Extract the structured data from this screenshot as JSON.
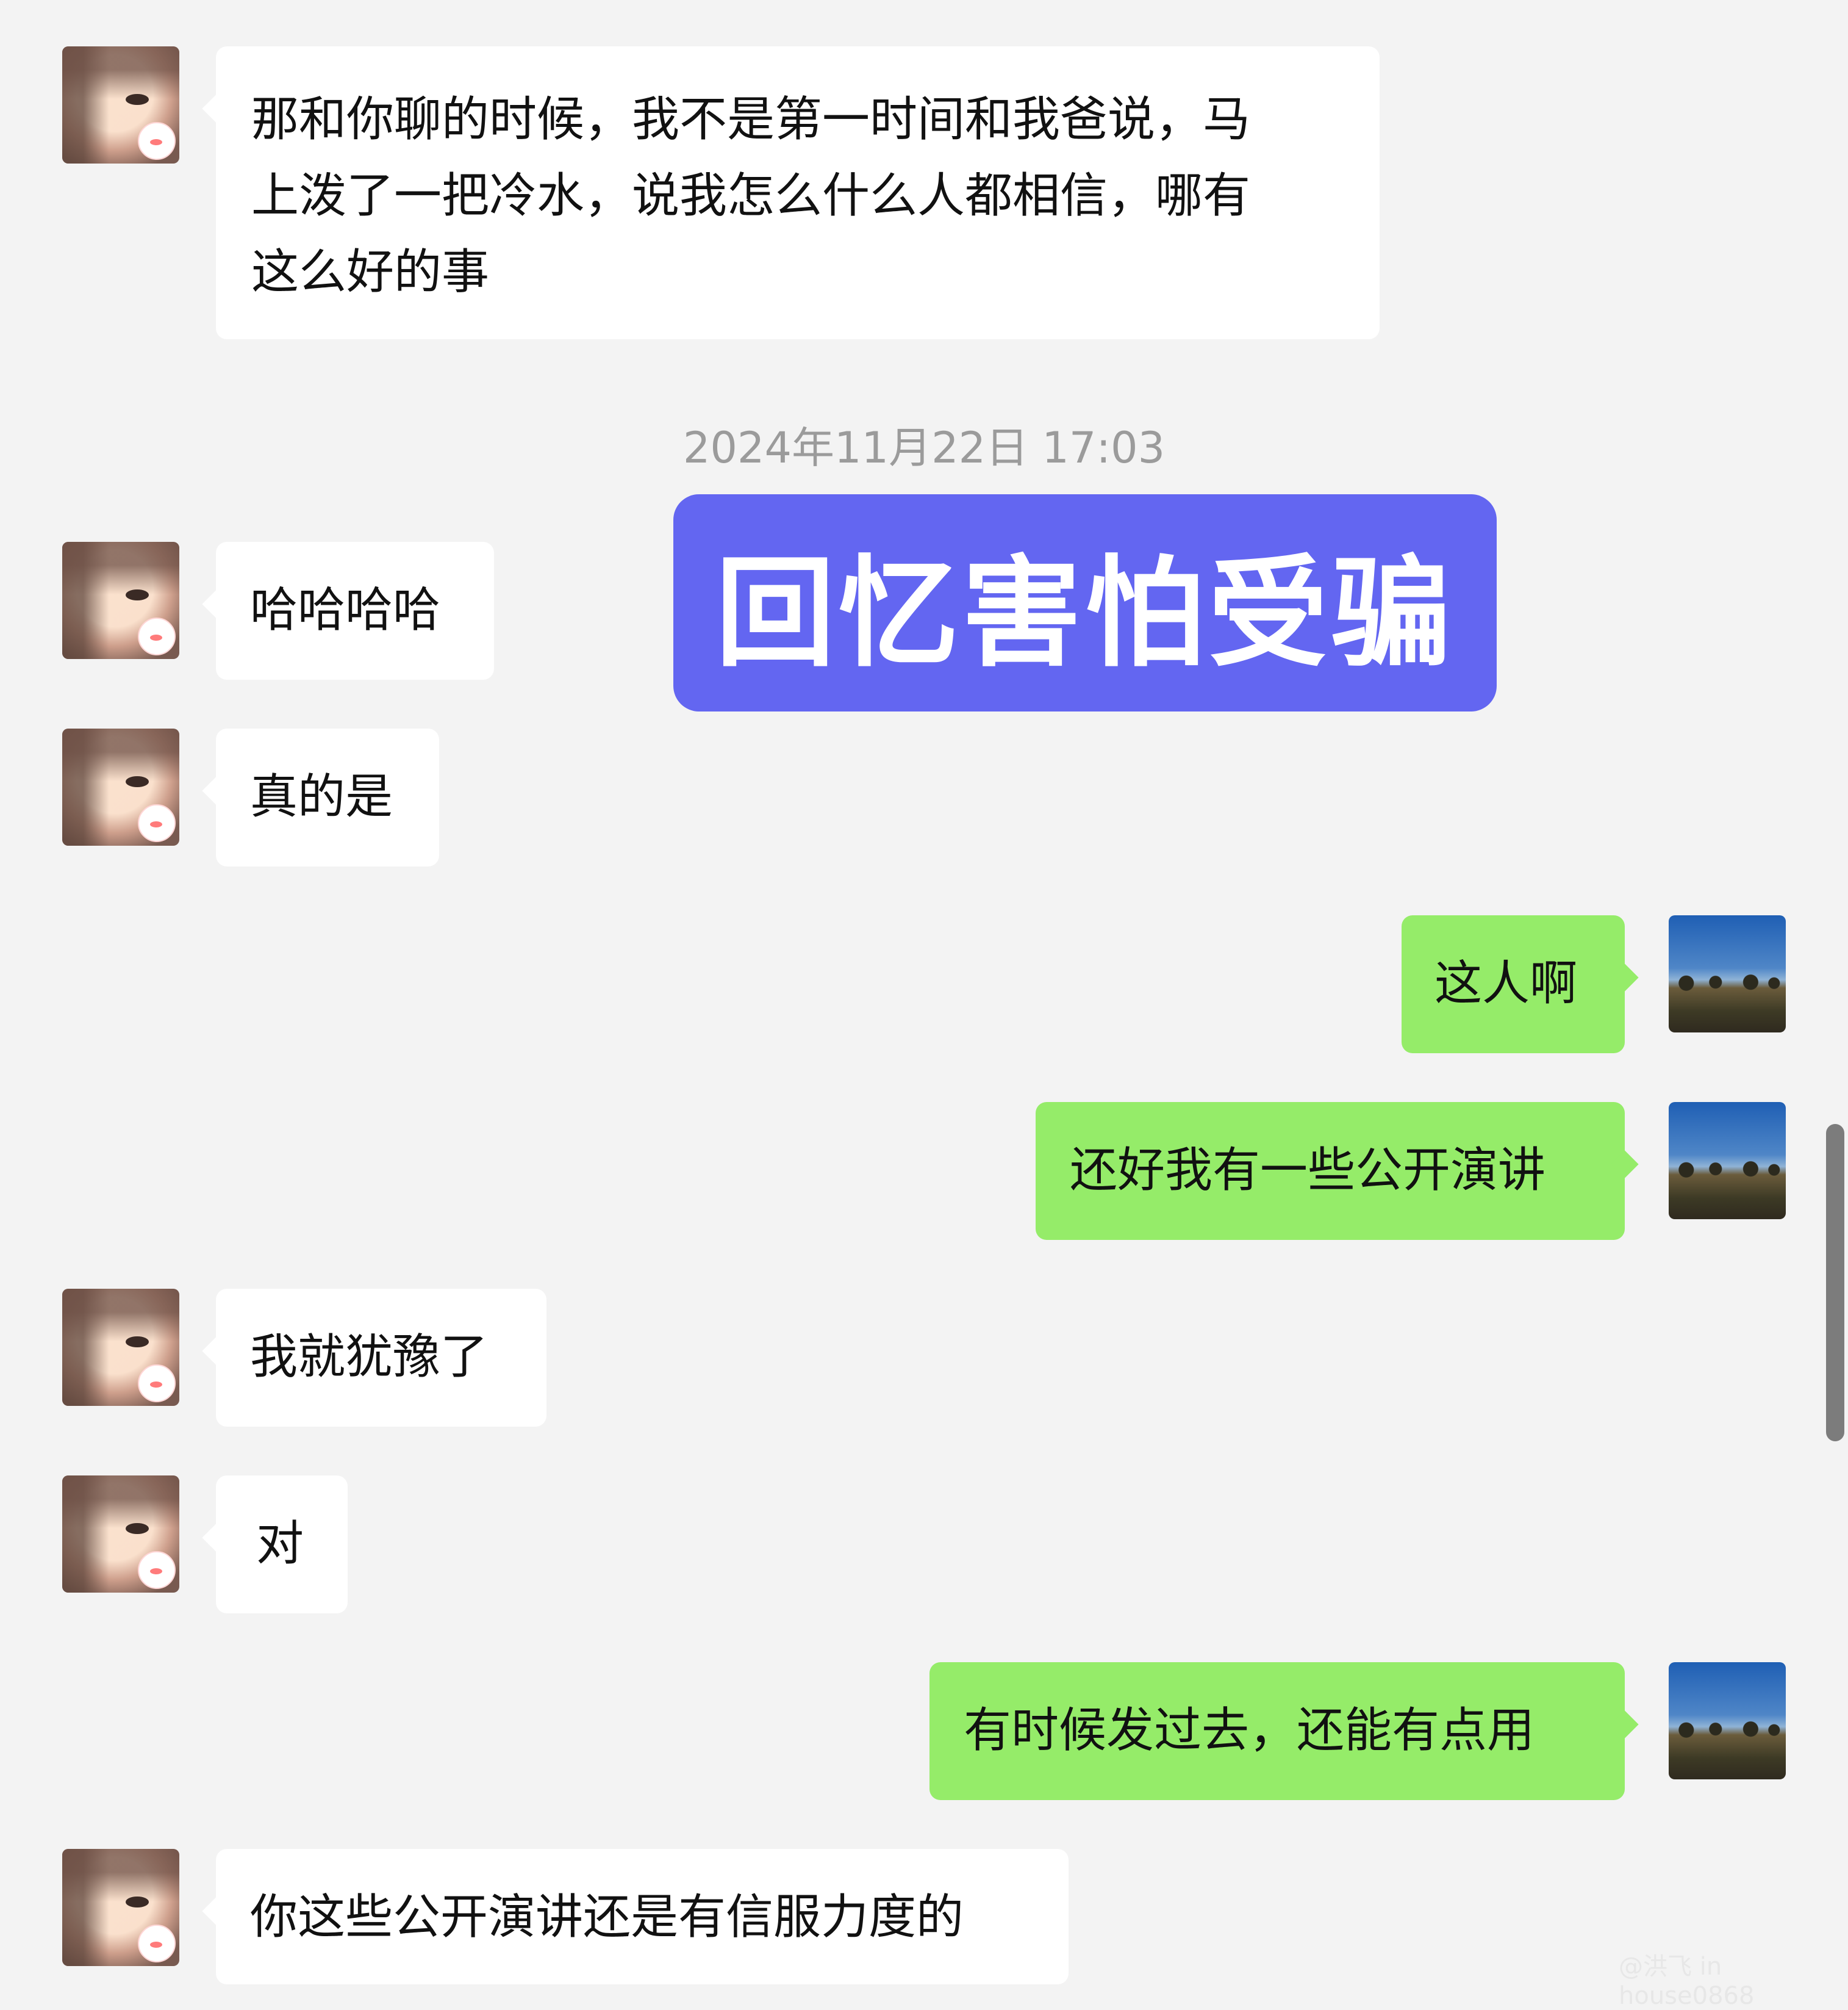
{
  "chat": {
    "timestamp": "2024年11月22日 17:03",
    "overlay_title": "回忆害怕受骗",
    "messages": [
      {
        "side": "left",
        "text": "那和你聊的时候，我不是第一时间和我爸说，马\n上泼了一把冷水，说我怎么什么人都相信，哪有\n这么好的事"
      },
      {
        "side": "left",
        "text": "哈哈哈哈"
      },
      {
        "side": "left",
        "text": "真的是"
      },
      {
        "side": "right",
        "text": "这人啊"
      },
      {
        "side": "right",
        "text": "还好我有一些公开演讲"
      },
      {
        "side": "left",
        "text": "我就犹豫了"
      },
      {
        "side": "left",
        "text": "对"
      },
      {
        "side": "right",
        "text": "有时候发过去，还能有点用"
      },
      {
        "side": "left",
        "text": "你这些公开演讲还是有信服力度的"
      }
    ]
  },
  "colors": {
    "background": "#f3f3f3",
    "left_bubble": "#ffffff",
    "right_bubble": "#95ec69",
    "timestamp": "#9b9b9b",
    "overlay": "#6366f1"
  },
  "watermark": "@洪飞 in house0868"
}
